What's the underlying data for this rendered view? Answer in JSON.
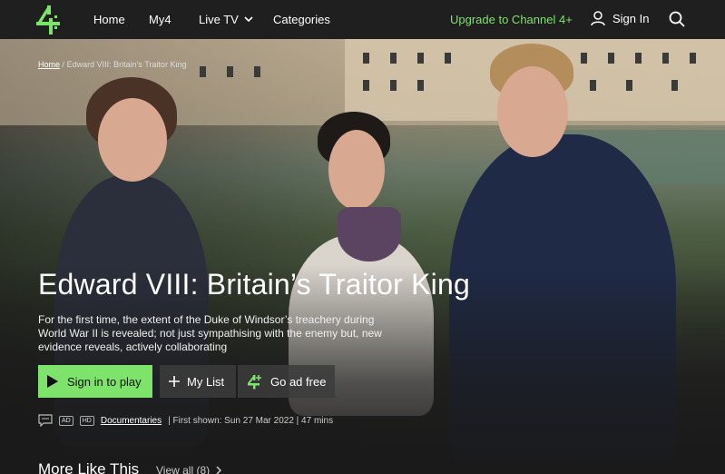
{
  "nav": {
    "links": [
      "Home",
      "My4",
      "Live TV",
      "Categories"
    ],
    "upgrade": "Upgrade to Channel 4+",
    "sign_in": "Sign In"
  },
  "breadcrumb": {
    "home": "Home",
    "separator": "/",
    "current": "Edward VIII: Britain’s Traitor King"
  },
  "programme": {
    "title": "Edward VIII: Britain’s Traitor King",
    "description": "For the first time, the extent of the Duke of Windsor’s treachery during World War II is revealed; not just sympathising with the enemy but, new evidence reveals, actively collaborating"
  },
  "actions": {
    "play": "Sign in to play",
    "my_list": "My List",
    "ad_free": "Go ad free"
  },
  "meta": {
    "ad_badge": "AD",
    "hd_badge": "HD",
    "genre": "Documentaries",
    "first_shown": "| First shown: Sun 27 Mar 2022 | 47 mins"
  },
  "more": {
    "title": "More Like This",
    "view_all": "View all (8)"
  },
  "colors": {
    "accent": "#7ee36a",
    "nav_bg": "#1f1f1f",
    "page_bg": "#1a1a1a"
  },
  "icons": [
    "channel4-logo",
    "chevron-down-icon",
    "user-icon",
    "search-icon",
    "play-icon",
    "plus-icon",
    "channel4-plus-icon",
    "subtitles-icon",
    "audio-description-icon",
    "hd-icon",
    "chevron-right-icon"
  ]
}
